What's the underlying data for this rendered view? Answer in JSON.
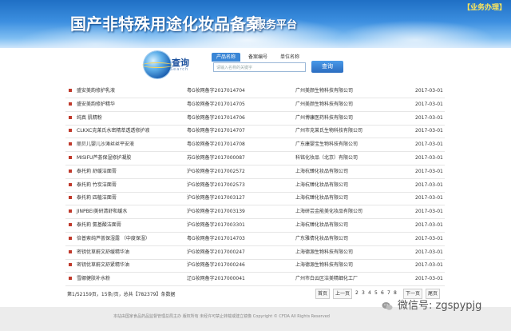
{
  "banner": {
    "title": "国产非特殊用途化妆品备案",
    "subtitle": "服务平台",
    "biz_link": "【业务办理】"
  },
  "search": {
    "label": "查询",
    "label_en": "Search",
    "tabs": [
      "产品名称",
      "备案编号",
      "单位名称"
    ],
    "placeholder": "请输入名称的关键字",
    "button": "查询"
  },
  "records": [
    {
      "name": "盛安美韵修护乳液",
      "code": "粤G妆网备字2017014704",
      "company": "广州美颜生物科技有限公司",
      "date": "2017-03-01"
    },
    {
      "name": "盛安美韵修护精华",
      "code": "粤G妆网备字2017014705",
      "company": "广州美颜生物科技有限公司",
      "date": "2017-03-01"
    },
    {
      "name": "纯真 肌精粉",
      "code": "粤G妆网备字2017014706",
      "company": "广州博康医药科技有限公司",
      "date": "2017-03-01"
    },
    {
      "name": "CLKXC克莱氏水密精萃透透修护液",
      "code": "粤G妆网备字2017014707",
      "company": "广州市克莱氏生物科技有限公司",
      "date": "2017-03-01"
    },
    {
      "name": "丽贝儿婴儿沙滩丝丝平安液",
      "code": "粤G妆网备字2017014708",
      "company": "广东康婴宝生物科技有限公司",
      "date": "2017-03-01"
    },
    {
      "name": "MISIFU芦荟保湿修护凝胶",
      "code": "苏G妆网备字2017000087",
      "company": "科铭化妆品（北京）有限公司",
      "date": "2017-03-01"
    },
    {
      "name": "泰托莉 舒缓洁面膏",
      "code": "沪G妆网备字2017002572",
      "company": "上海杭臻化妆品有限公司",
      "date": "2017-03-01"
    },
    {
      "name": "泰托莉 竹炭洁面膏",
      "code": "沪G妆网备字2017002573",
      "company": "上海杭臻化妆品有限公司",
      "date": "2017-03-01"
    },
    {
      "name": "泰托莉 四植洁面膏",
      "code": "沪G妆网备字2017003127",
      "company": "上海杭臻化妆品有限公司",
      "date": "2017-03-01"
    },
    {
      "name": "JINPBEI美研清舒和缓水",
      "code": "沪G妆网备字2017003139",
      "company": "上海研芸金能美化妆品有限公司",
      "date": "2017-03-01"
    },
    {
      "name": "泰托莉 氨基酸洁面膏",
      "code": "沪G妆网备字2017003301",
      "company": "上海杭臻化妆品有限公司",
      "date": "2017-03-01"
    },
    {
      "name": "倍普索纯芦荟保湿露 （中度保湿）",
      "code": "粤G妆网备字2017014703",
      "company": "广东雅倩化妆品有限公司",
      "date": "2017-03-01"
    },
    {
      "name": "密钥优草蔚文舒缓精华油",
      "code": "沪G妆网备字2017000247",
      "company": "上海德源生物科技有限公司",
      "date": "2017-03-01"
    },
    {
      "name": "密钥优草蔚文舒紧精华油",
      "code": "沪G妆网备字2017000246",
      "company": "上海德源生物科技有限公司",
      "date": "2017-03-01"
    },
    {
      "name": "雪娜健肤补水粉",
      "code": "辽G妆网备字2017000041",
      "company": "广州市白云区洁美精细化工厂",
      "date": "2017-03-01"
    }
  ],
  "pager": {
    "info": "第1/52159页，15条/页，总共【782379】条数据",
    "first": "首页",
    "prev": "上一页",
    "pages": [
      "2",
      "3",
      "4",
      "5",
      "6",
      "7",
      "8"
    ],
    "next": "下一页",
    "last": "尾页"
  },
  "footer": {
    "text": "本站由国家食品药品监督管理总局主办 版权所有 未经许可禁止转载或建立镜像 Copyright © CFDA All Rights Reserved"
  },
  "watermark": {
    "icon": "wechat-icon",
    "text": "微信号: zgspypjg"
  },
  "colors": {
    "banner_blue": "#2a78cc",
    "accent": "#3a86d6",
    "bullet": "#c0392b"
  }
}
